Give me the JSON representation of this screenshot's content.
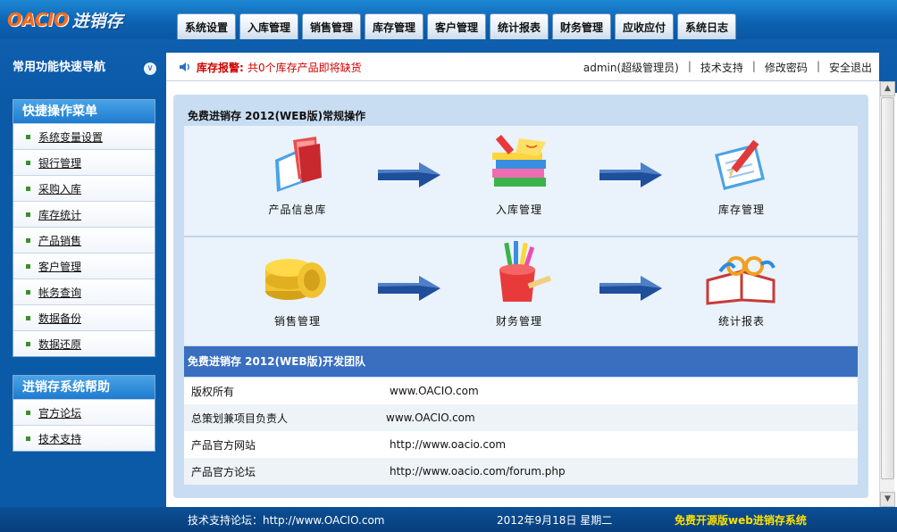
{
  "logo": {
    "en": "OACIO",
    "cn": "进销存"
  },
  "tabs": [
    "系统设置",
    "入库管理",
    "销售管理",
    "库存管理",
    "客户管理",
    "统计报表",
    "财务管理",
    "应收应付",
    "系统日志"
  ],
  "nav": {
    "title": "常用功能快速导航",
    "collapse_icon": "double-chevron-down-icon"
  },
  "alert": {
    "label": "库存报警:",
    "text": "共0个库存产品即将缺货"
  },
  "user": {
    "name": "admin(超级管理员)",
    "support": "技术支持",
    "change_password": "修改密码",
    "logout": "安全退出"
  },
  "quick_menu": {
    "title": "快捷操作菜单",
    "items": [
      "系统变量设置",
      "银行管理",
      "采购入库",
      "库存统计",
      "产品销售",
      "客户管理",
      "帐务查询",
      "数据备份",
      "数据还原"
    ]
  },
  "help_menu": {
    "title": "进销存系统帮助",
    "items": [
      "官方论坛",
      "技术支持"
    ]
  },
  "main": {
    "title": "免费进销存 2012(WEB版)常规操作",
    "steps": [
      {
        "label": "产品信息库",
        "icon": "books-icon"
      },
      {
        "label": "入库管理",
        "icon": "stacked-books-icon"
      },
      {
        "label": "库存管理",
        "icon": "clipboard-pencil-icon"
      },
      {
        "label": "销售管理",
        "icon": "coins-icon"
      },
      {
        "label": "财务管理",
        "icon": "pencil-cup-icon"
      },
      {
        "label": "统计报表",
        "icon": "open-book-glasses-icon"
      }
    ]
  },
  "team": {
    "title": "免费进销存 2012(WEB版)开发团队",
    "rows": [
      {
        "key": "版权所有",
        "value": "www.OACIO.com"
      },
      {
        "key": "总策划兼项目负责人",
        "value": "www.OACIO.com"
      },
      {
        "key": "产品官方网站",
        "value": "http://www.oacio.com"
      },
      {
        "key": "产品官方论坛",
        "value": "http://www.oacio.com/forum.php"
      }
    ]
  },
  "footer": {
    "support": "技术支持论坛：http://www.OACIO.com",
    "date": "2012年9月18日 星期二",
    "slogan": "免费开源版web进销存系统"
  },
  "colors": {
    "header_blue": "#0b5aa8",
    "alert_red": "#d10000",
    "team_head": "#3a6fc0",
    "slogan_yellow": "#ffe100"
  }
}
